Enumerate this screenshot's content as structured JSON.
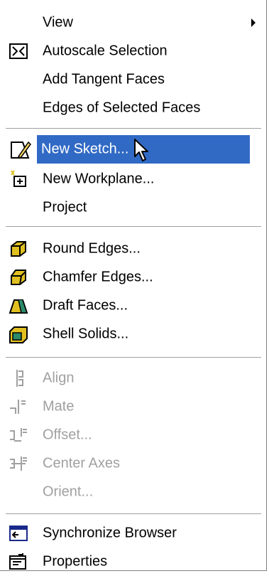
{
  "menu": {
    "items": [
      {
        "label": "View",
        "icon": "",
        "submenu": true
      },
      {
        "label": "Autoscale Selection",
        "icon": "autoscale-icon"
      },
      {
        "label": "Add Tangent Faces",
        "icon": ""
      },
      {
        "label": "Edges of Selected Faces",
        "icon": ""
      },
      {
        "label": "New Sketch...",
        "icon": "sketch-pencil-icon",
        "selected": true
      },
      {
        "label": "New Workplane...",
        "icon": "workplane-icon"
      },
      {
        "label": "Project",
        "icon": ""
      },
      {
        "label": "Round Edges...",
        "icon": "round-edges-icon"
      },
      {
        "label": "Chamfer Edges...",
        "icon": "chamfer-edges-icon"
      },
      {
        "label": "Draft Faces...",
        "icon": "draft-faces-icon"
      },
      {
        "label": "Shell Solids...",
        "icon": "shell-solids-icon"
      },
      {
        "label": "Align",
        "icon": "align-icon",
        "disabled": true
      },
      {
        "label": "Mate",
        "icon": "mate-icon",
        "disabled": true
      },
      {
        "label": "Offset...",
        "icon": "offset-icon",
        "disabled": true
      },
      {
        "label": "Center Axes",
        "icon": "center-axes-icon",
        "disabled": true
      },
      {
        "label": "Orient...",
        "icon": "",
        "disabled": true
      },
      {
        "label": "Synchronize Browser",
        "icon": "synchronize-browser-icon"
      },
      {
        "label": "Properties",
        "icon": "properties-icon"
      }
    ]
  },
  "colors": {
    "selection": "#316ac5",
    "disabled_text": "#a0a0a0"
  }
}
